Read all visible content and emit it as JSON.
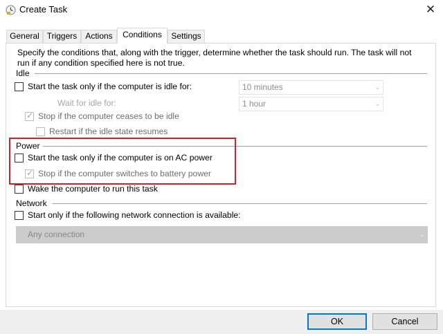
{
  "window": {
    "title": "Create Task",
    "close_glyph": "✕"
  },
  "tabs": [
    {
      "label": "General"
    },
    {
      "label": "Triggers"
    },
    {
      "label": "Actions"
    },
    {
      "label": "Conditions"
    },
    {
      "label": "Settings"
    }
  ],
  "description": "Specify the conditions that, along with the trigger, determine whether the task should run.  The task will not run  if any condition specified here is not true.",
  "idle": {
    "section_label": "Idle",
    "start_if_idle": {
      "label": "Start the task only if the computer is idle for:",
      "checked": false
    },
    "idle_duration": {
      "value": "10 minutes"
    },
    "wait_label": "Wait for idle for:",
    "wait_duration": {
      "value": "1 hour"
    },
    "stop_if_not_idle": {
      "label": "Stop if the computer ceases to be idle",
      "checked": true
    },
    "restart_if_idle": {
      "label": "Restart if the idle state resumes",
      "checked": false
    }
  },
  "power": {
    "section_label": "Power",
    "start_on_ac": {
      "label": "Start the task only if the computer is on AC power",
      "checked": false
    },
    "stop_on_battery": {
      "label": "Stop if the computer switches to battery power",
      "checked": true
    },
    "wake_to_run": {
      "label": "Wake the computer to run this task",
      "checked": false
    }
  },
  "network": {
    "section_label": "Network",
    "start_if_network": {
      "label": "Start only if the following network connection is available:",
      "checked": false
    },
    "connection": {
      "value": "Any connection"
    }
  },
  "buttons": {
    "ok": "OK",
    "cancel": "Cancel"
  },
  "colors": {
    "highlight_border": "#d0202a",
    "default_button_border": "#0078d7"
  },
  "icons": {
    "title": "task-scheduler-clock-icon",
    "dropdown": "chevron-down-icon",
    "checkmark": "checkmark-icon"
  }
}
